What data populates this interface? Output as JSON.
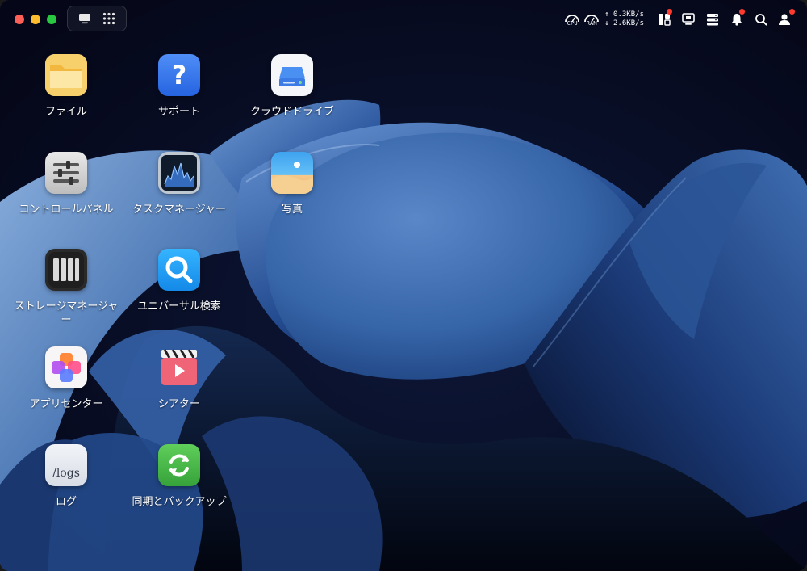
{
  "window": {
    "controls": [
      "close",
      "minimize",
      "maximize"
    ]
  },
  "topbar": {
    "view_switch": [
      "desktop-view-icon",
      "apps-grid-icon"
    ],
    "cpu_label": "CPU",
    "ram_label": "RAM",
    "upload_speed": "↑ 0.3KB/s",
    "download_speed": "↓ 2.6KB/s",
    "tray_icons": [
      "widgets-icon",
      "monitor-icon",
      "server-icon",
      "bell-icon",
      "search-icon",
      "user-icon"
    ]
  },
  "desktop": {
    "apps": [
      {
        "label": "ファイル",
        "icon": "folder-icon"
      },
      {
        "label": "サポート",
        "icon": "help-icon"
      },
      {
        "label": "クラウドドライブ",
        "icon": "cloud-drive-icon"
      },
      {
        "label": "コントロールパネル",
        "icon": "sliders-icon"
      },
      {
        "label": "タスクマネージャー",
        "icon": "activity-chart-icon"
      },
      {
        "label": "写真",
        "icon": "photo-icon"
      },
      {
        "label": "ストレージマネージャー",
        "icon": "storage-icon"
      },
      {
        "label": "ユニバーサル検索",
        "icon": "magnifier-icon"
      },
      {
        "label": "アプリセンター",
        "icon": "app-center-icon"
      },
      {
        "label": "シアター",
        "icon": "theater-icon"
      },
      {
        "label": "ログ",
        "icon": "logs-icon",
        "tile_text": "/logs"
      },
      {
        "label": "同期とバックアップ",
        "icon": "sync-icon"
      }
    ]
  },
  "colors": {
    "accent_blue": "#2f7cf6",
    "notification_red": "#ff3b30",
    "background": "#070a22"
  }
}
